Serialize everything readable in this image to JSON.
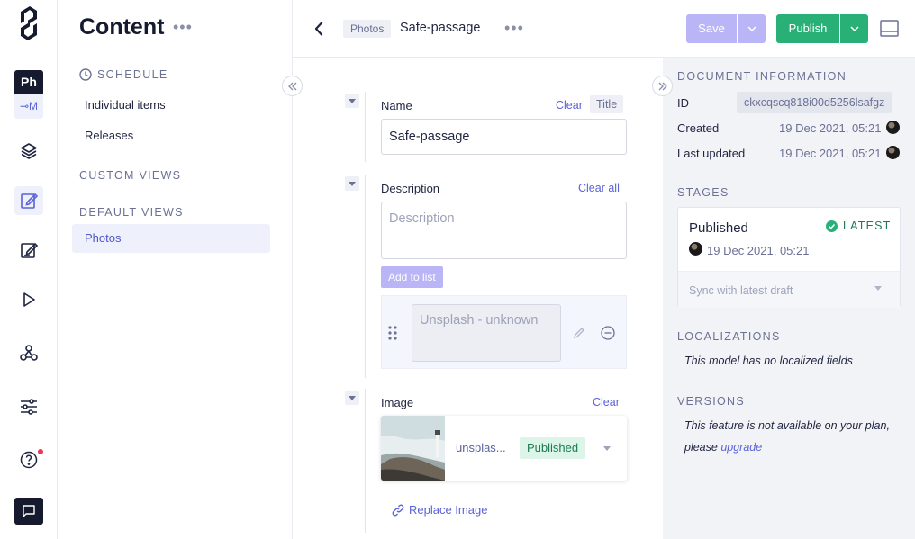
{
  "rail": {
    "project_badge": "Ph",
    "env_badge": "⊸M",
    "icons": [
      "logo-icon",
      "layers-icon",
      "content-icon",
      "edit-icon",
      "play-icon",
      "webhook-icon",
      "sliders-icon",
      "help-icon",
      "chat-icon"
    ]
  },
  "sidebar": {
    "title": "Content",
    "more": "•••",
    "schedule_label": "SCHEDULE",
    "schedule_items": [
      "Individual items",
      "Releases"
    ],
    "custom_views_label": "CUSTOM VIEWS",
    "default_views_label": "DEFAULT VIEWS",
    "default_views": [
      "Photos"
    ]
  },
  "topbar": {
    "model": "Photos",
    "entry": "Safe-passage",
    "more": "•••",
    "save_label": "Save",
    "publish_label": "Publish"
  },
  "form": {
    "name": {
      "label": "Name",
      "clear": "Clear",
      "title_tag": "Title",
      "value": "Safe-passage"
    },
    "description": {
      "label": "Description",
      "clear": "Clear all",
      "placeholder": "Description",
      "add_to_list": "Add to list",
      "list_items": [
        "Unsplash - unknown"
      ]
    },
    "image": {
      "label": "Image",
      "clear": "Clear",
      "filename": "unsplas...",
      "status": "Published",
      "replace": "Replace Image"
    }
  },
  "info": {
    "doc_section": "DOCUMENT INFORMATION",
    "id_label": "ID",
    "id_value": "ckxcqscq818i00d5256lsafgz",
    "created_label": "Created",
    "created_value": "19 Dec 2021, 05:21",
    "updated_label": "Last updated",
    "updated_value": "19 Dec 2021, 05:21",
    "stages_section": "STAGES",
    "stage": {
      "name": "Published",
      "badge": "LATEST",
      "date": "19 Dec 2021, 05:21",
      "sync": "Sync with latest draft"
    },
    "loc_section": "LOCALIZATIONS",
    "loc_note": "This model has no localized fields",
    "versions_section": "VERSIONS",
    "versions_note_1": "This feature is not available on your plan,",
    "versions_note_2": "please ",
    "versions_link": "upgrade"
  },
  "colors": {
    "accent": "#5a63d8",
    "publish": "#28b077",
    "save_disabled": "#b9b5f7",
    "rail_dark": "#161a2e"
  }
}
